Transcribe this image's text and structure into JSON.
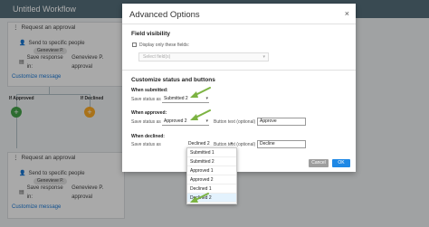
{
  "app": {
    "title": "Untitled Workflow"
  },
  "workflow": {
    "step1": {
      "title": "Request an approval",
      "send_to": "Send to specific people",
      "person": "Genevieve P.",
      "save_response_in": "Save response in:",
      "save_value": "Genevieve P. approval",
      "customize": "Customize message"
    },
    "branches": {
      "approved": "If Approved",
      "declined": "If Declined"
    },
    "step2": {
      "title": "Request an approval",
      "send_to": "Send to specific people",
      "person": "Genevieve P.",
      "save_response_in": "Save response in:",
      "save_value": "Genevieve P. approval",
      "customize": "Customize message"
    }
  },
  "dialog": {
    "title": "Advanced Options",
    "close": "×",
    "field_visibility": {
      "heading": "Field visibility",
      "checkbox_label": "Display only these fields:",
      "select_placeholder": "Select field(s)"
    },
    "customize": {
      "heading": "Customize status and buttons",
      "submitted": {
        "label": "When submitted:",
        "status_label": "Save status as",
        "status": "Submitted 2"
      },
      "approved": {
        "label": "When approved:",
        "status_label": "Save status as",
        "status": "Approved 2",
        "button_label": "Button text (optional)",
        "button_text": "Approve"
      },
      "declined": {
        "label": "When declined:",
        "status_label": "Save status as",
        "status": "Declined 2",
        "button_label": "Button text (optional)",
        "button_text": "Decline"
      }
    },
    "buttons": {
      "cancel": "Cancel",
      "ok": "OK"
    },
    "dropdown_options": [
      "Submitted 1",
      "Submitted 2",
      "Approved 1",
      "Approved 2",
      "Declined 1",
      "Declined 2"
    ]
  },
  "colors": {
    "topbar": "#546e7a",
    "approve_plus": "#43a047",
    "decline_plus": "#f9a825",
    "arrow": "#7cb342",
    "ok": "#1e88e5"
  }
}
